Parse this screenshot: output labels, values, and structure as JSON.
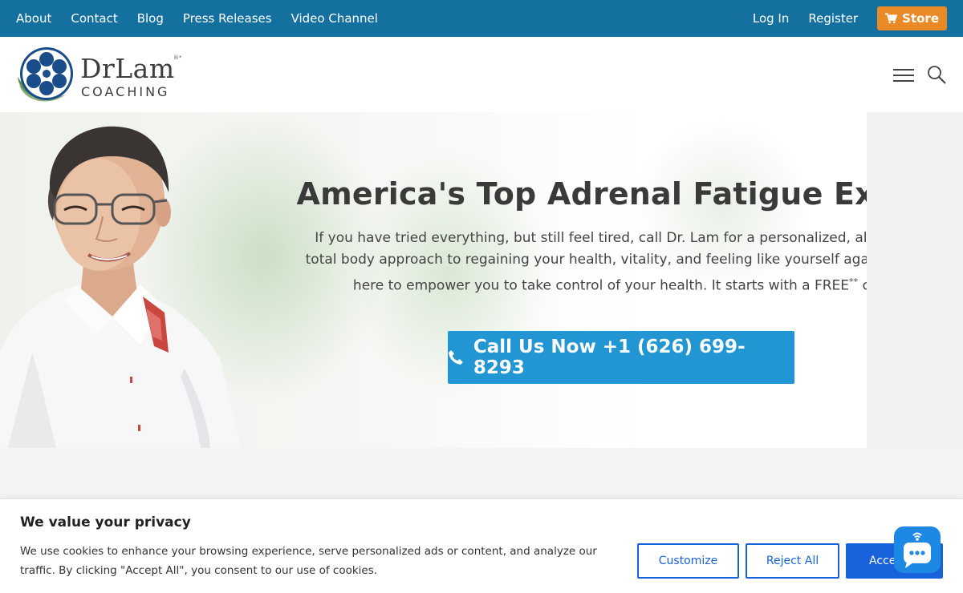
{
  "topbar": {
    "nav": [
      "About",
      "Contact",
      "Blog",
      "Press Releases",
      "Video Channel"
    ],
    "login": "Log In",
    "register": "Register",
    "store": "Store"
  },
  "header": {
    "logo_name": "DrLam",
    "logo_sub": "COACHING",
    "logo_mark": "®*"
  },
  "hero": {
    "title": "America's Top Adrenal Fatigue Expert",
    "text": "If you have tried everything, but still feel tired, call Dr. Lam for a personalized, all natural, total body approach to regaining your health, vitality, and feeling like yourself again. We are here to empower you to take control of your health. It starts with a FREE",
    "text_sup": "**",
    "text_end": " call.",
    "call_label": "Call Us Now +1 (626) 699-8293"
  },
  "cookie": {
    "title": "We value your privacy",
    "text": "We use cookies to enhance your browsing experience, serve personalized ads or content, and analyze our traffic. By clicking \"Accept All\", you consent to our use of cookies.",
    "customize": "Customize",
    "reject": "Reject All",
    "accept": "Accept All"
  },
  "colors": {
    "topbar": "#13709f",
    "store": "#e98a27",
    "call_button": "#2196d3",
    "cookie_accent": "#1863dc"
  }
}
